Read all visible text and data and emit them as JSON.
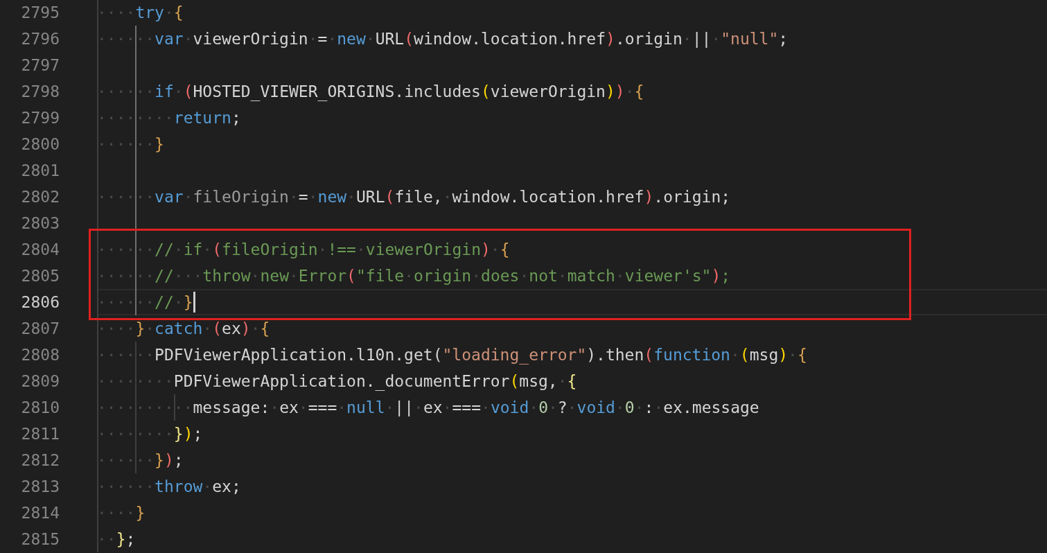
{
  "editor": {
    "lines": [
      {
        "number": "2795",
        "current": false,
        "tokens": [
          {
            "kind": "ws",
            "text": "····"
          },
          {
            "kind": "kw",
            "text": "try"
          },
          {
            "kind": "ws",
            "text": "·"
          },
          {
            "kind": "brace",
            "text": "{"
          }
        ]
      },
      {
        "number": "2796",
        "current": false,
        "tokens": [
          {
            "kind": "ws",
            "text": "······"
          },
          {
            "kind": "kw",
            "text": "var"
          },
          {
            "kind": "ws",
            "text": "·"
          },
          {
            "kind": "id",
            "text": "viewerOrigin"
          },
          {
            "kind": "ws",
            "text": "·"
          },
          {
            "kind": "id",
            "text": "="
          },
          {
            "kind": "ws",
            "text": "·"
          },
          {
            "kind": "kw",
            "text": "new"
          },
          {
            "kind": "ws",
            "text": "·"
          },
          {
            "kind": "id",
            "text": "URL"
          },
          {
            "kind": "red",
            "text": "("
          },
          {
            "kind": "id",
            "text": "window.location.href"
          },
          {
            "kind": "red",
            "text": ")"
          },
          {
            "kind": "id",
            "text": ".origin"
          },
          {
            "kind": "ws",
            "text": "·"
          },
          {
            "kind": "id",
            "text": "||"
          },
          {
            "kind": "ws",
            "text": "·"
          },
          {
            "kind": "str",
            "text": "\"null\""
          },
          {
            "kind": "id",
            "text": ";"
          }
        ]
      },
      {
        "number": "2797",
        "current": false
      },
      {
        "number": "2798",
        "current": false,
        "tokens": [
          {
            "kind": "ws",
            "text": "······"
          },
          {
            "kind": "kw",
            "text": "if"
          },
          {
            "kind": "ws",
            "text": "·"
          },
          {
            "kind": "red",
            "text": "("
          },
          {
            "kind": "id",
            "text": "HOSTED_VIEWER_ORIGINS.includes"
          },
          {
            "kind": "gold",
            "text": "("
          },
          {
            "kind": "id",
            "text": "viewerOrigin"
          },
          {
            "kind": "gold",
            "text": ")"
          },
          {
            "kind": "red",
            "text": ")"
          },
          {
            "kind": "ws",
            "text": "·"
          },
          {
            "kind": "brace",
            "text": "{"
          }
        ]
      },
      {
        "number": "2799",
        "current": false,
        "tokens": [
          {
            "kind": "ws",
            "text": "········"
          },
          {
            "kind": "kw",
            "text": "return"
          },
          {
            "kind": "id",
            "text": ";"
          }
        ]
      },
      {
        "number": "2800",
        "current": false,
        "tokens": [
          {
            "kind": "ws",
            "text": "······"
          },
          {
            "kind": "brace",
            "text": "}"
          }
        ]
      },
      {
        "number": "2801",
        "current": false
      },
      {
        "number": "2802",
        "current": false,
        "tokens": [
          {
            "kind": "ws",
            "text": "······"
          },
          {
            "kind": "kw",
            "text": "var"
          },
          {
            "kind": "ws",
            "text": "·"
          },
          {
            "kind": "dim",
            "text": "fileOrigin"
          },
          {
            "kind": "ws",
            "text": "·"
          },
          {
            "kind": "id",
            "text": "="
          },
          {
            "kind": "ws",
            "text": "·"
          },
          {
            "kind": "kw",
            "text": "new"
          },
          {
            "kind": "ws",
            "text": "·"
          },
          {
            "kind": "id",
            "text": "URL"
          },
          {
            "kind": "red",
            "text": "("
          },
          {
            "kind": "id",
            "text": "file,"
          },
          {
            "kind": "ws",
            "text": "·"
          },
          {
            "kind": "id",
            "text": "window.location.href"
          },
          {
            "kind": "red",
            "text": ")"
          },
          {
            "kind": "id",
            "text": ".origin;"
          }
        ]
      },
      {
        "number": "2803",
        "current": false
      },
      {
        "number": "2804",
        "current": false,
        "tokens": [
          {
            "kind": "ws",
            "text": "······"
          },
          {
            "kind": "cm",
            "text": "//"
          },
          {
            "kind": "ws",
            "text": "·"
          },
          {
            "kind": "cm",
            "text": "if"
          },
          {
            "kind": "ws",
            "text": "·"
          },
          {
            "kind": "red",
            "text": "("
          },
          {
            "kind": "cm",
            "text": "fileOrigin"
          },
          {
            "kind": "ws",
            "text": "·"
          },
          {
            "kind": "cm",
            "text": "!=="
          },
          {
            "kind": "ws",
            "text": "·"
          },
          {
            "kind": "cm",
            "text": "viewerOrigin"
          },
          {
            "kind": "red",
            "text": ")"
          },
          {
            "kind": "ws",
            "text": "·"
          },
          {
            "kind": "brace",
            "text": "{"
          }
        ]
      },
      {
        "number": "2805",
        "current": false,
        "tokens": [
          {
            "kind": "ws",
            "text": "······"
          },
          {
            "kind": "cm",
            "text": "//"
          },
          {
            "kind": "ws",
            "text": "···"
          },
          {
            "kind": "cm",
            "text": "throw"
          },
          {
            "kind": "ws",
            "text": "·"
          },
          {
            "kind": "cm",
            "text": "new"
          },
          {
            "kind": "ws",
            "text": "·"
          },
          {
            "kind": "cm",
            "text": "Error"
          },
          {
            "kind": "red",
            "text": "("
          },
          {
            "kind": "cm",
            "text": "\"file"
          },
          {
            "kind": "ws",
            "text": "·"
          },
          {
            "kind": "cm",
            "text": "origin"
          },
          {
            "kind": "ws",
            "text": "·"
          },
          {
            "kind": "cm",
            "text": "does"
          },
          {
            "kind": "ws",
            "text": "·"
          },
          {
            "kind": "cm",
            "text": "not"
          },
          {
            "kind": "ws",
            "text": "·"
          },
          {
            "kind": "cm",
            "text": "match"
          },
          {
            "kind": "ws",
            "text": "·"
          },
          {
            "kind": "cm",
            "text": "viewer's\""
          },
          {
            "kind": "red",
            "text": ")"
          },
          {
            "kind": "cm",
            "text": ";"
          }
        ]
      },
      {
        "number": "2806",
        "current": true,
        "tokens": [
          {
            "kind": "ws",
            "text": "······"
          },
          {
            "kind": "cm",
            "text": "//"
          },
          {
            "kind": "ws",
            "text": "·"
          },
          {
            "kind": "brace",
            "text": "}"
          }
        ]
      },
      {
        "number": "2807",
        "current": false,
        "tokens": [
          {
            "kind": "ws",
            "text": "····"
          },
          {
            "kind": "brace",
            "text": "}"
          },
          {
            "kind": "ws",
            "text": "·"
          },
          {
            "kind": "kw",
            "text": "catch"
          },
          {
            "kind": "ws",
            "text": "·"
          },
          {
            "kind": "red",
            "text": "("
          },
          {
            "kind": "id",
            "text": "ex"
          },
          {
            "kind": "red",
            "text": ")"
          },
          {
            "kind": "ws",
            "text": "·"
          },
          {
            "kind": "brace",
            "text": "{"
          }
        ]
      },
      {
        "number": "2808",
        "current": false,
        "tokens": [
          {
            "kind": "ws",
            "text": "······"
          },
          {
            "kind": "id",
            "text": "PDFViewerApplication.l10n.get("
          },
          {
            "kind": "str",
            "text": "\"loading_error\""
          },
          {
            "kind": "id",
            "text": ").then"
          },
          {
            "kind": "red",
            "text": "("
          },
          {
            "kind": "kw",
            "text": "function"
          },
          {
            "kind": "ws",
            "text": "·"
          },
          {
            "kind": "gold",
            "text": "("
          },
          {
            "kind": "id",
            "text": "msg"
          },
          {
            "kind": "gold",
            "text": ")"
          },
          {
            "kind": "ws",
            "text": "·"
          },
          {
            "kind": "brace",
            "text": "{"
          }
        ]
      },
      {
        "number": "2809",
        "current": false,
        "tokens": [
          {
            "kind": "ws",
            "text": "········"
          },
          {
            "kind": "id",
            "text": "PDFViewerApplication._documentError"
          },
          {
            "kind": "gold",
            "text": "("
          },
          {
            "kind": "id",
            "text": "msg,"
          },
          {
            "kind": "ws",
            "text": "·"
          },
          {
            "kind": "yel",
            "text": "{"
          }
        ]
      },
      {
        "number": "2810",
        "current": false,
        "tokens": [
          {
            "kind": "ws",
            "text": "··········"
          },
          {
            "kind": "id",
            "text": "message:"
          },
          {
            "kind": "ws",
            "text": "·"
          },
          {
            "kind": "id",
            "text": "ex"
          },
          {
            "kind": "ws",
            "text": "·"
          },
          {
            "kind": "id",
            "text": "==="
          },
          {
            "kind": "ws",
            "text": "·"
          },
          {
            "kind": "kw",
            "text": "null"
          },
          {
            "kind": "ws",
            "text": "·"
          },
          {
            "kind": "id",
            "text": "||"
          },
          {
            "kind": "ws",
            "text": "·"
          },
          {
            "kind": "id",
            "text": "ex"
          },
          {
            "kind": "ws",
            "text": "·"
          },
          {
            "kind": "id",
            "text": "==="
          },
          {
            "kind": "ws",
            "text": "·"
          },
          {
            "kind": "kw",
            "text": "void"
          },
          {
            "kind": "ws",
            "text": "·"
          },
          {
            "kind": "num",
            "text": "0"
          },
          {
            "kind": "ws",
            "text": "·"
          },
          {
            "kind": "id",
            "text": "?"
          },
          {
            "kind": "ws",
            "text": "·"
          },
          {
            "kind": "kw",
            "text": "void"
          },
          {
            "kind": "ws",
            "text": "·"
          },
          {
            "kind": "num",
            "text": "0"
          },
          {
            "kind": "ws",
            "text": "·"
          },
          {
            "kind": "id",
            "text": ":"
          },
          {
            "kind": "ws",
            "text": "·"
          },
          {
            "kind": "id",
            "text": "ex.message"
          }
        ]
      },
      {
        "number": "2811",
        "current": false,
        "tokens": [
          {
            "kind": "ws",
            "text": "········"
          },
          {
            "kind": "yel",
            "text": "}"
          },
          {
            "kind": "gold",
            "text": ")"
          },
          {
            "kind": "id",
            "text": ";"
          }
        ]
      },
      {
        "number": "2812",
        "current": false,
        "tokens": [
          {
            "kind": "ws",
            "text": "······"
          },
          {
            "kind": "brace",
            "text": "}"
          },
          {
            "kind": "red",
            "text": ")"
          },
          {
            "kind": "id",
            "text": ";"
          }
        ]
      },
      {
        "number": "2813",
        "current": false,
        "tokens": [
          {
            "kind": "ws",
            "text": "······"
          },
          {
            "kind": "kw",
            "text": "throw"
          },
          {
            "kind": "ws",
            "text": "·"
          },
          {
            "kind": "id",
            "text": "ex;"
          }
        ]
      },
      {
        "number": "2814",
        "current": false,
        "tokens": [
          {
            "kind": "ws",
            "text": "····"
          },
          {
            "kind": "brace",
            "text": "}"
          }
        ]
      },
      {
        "number": "2815",
        "current": false,
        "tokens": [
          {
            "kind": "ws",
            "text": "··"
          },
          {
            "kind": "yel",
            "text": "}"
          },
          {
            "kind": "id",
            "text": ";"
          }
        ]
      }
    ]
  }
}
